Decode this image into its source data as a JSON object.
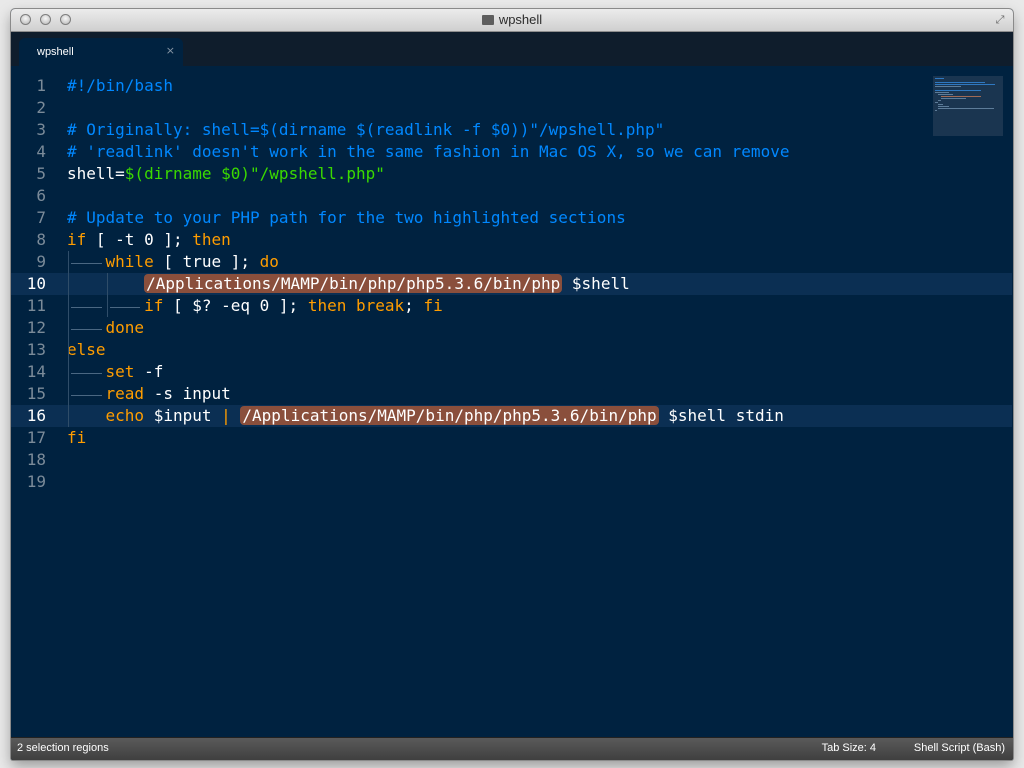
{
  "window": {
    "title": "wpshell"
  },
  "tabs": [
    {
      "label": "wpshell",
      "close": "×"
    }
  ],
  "editor": {
    "line_numbers": [
      "1",
      "2",
      "3",
      "4",
      "5",
      "6",
      "7",
      "8",
      "9",
      "10",
      "11",
      "12",
      "13",
      "14",
      "15",
      "16",
      "17",
      "18",
      "19"
    ],
    "highlighted_lines": [
      10,
      16
    ],
    "lines": [
      [
        {
          "t": "#!/bin/bash",
          "c": "comment"
        }
      ],
      [],
      [
        {
          "t": "# Originally: shell=$(dirname $(readlink -f $0))\"/wpshell.php\"",
          "c": "comment"
        }
      ],
      [
        {
          "t": "# 'readlink' doesn't work in the same fashion in Mac OS X, so we can remove",
          "c": "comment"
        }
      ],
      [
        {
          "t": "shell=",
          "c": "plain"
        },
        {
          "t": "$(",
          "c": "string"
        },
        {
          "t": "dirname $0",
          "c": "string"
        },
        {
          "t": ")",
          "c": "string"
        },
        {
          "t": "\"/wpshell.php\"",
          "c": "string"
        }
      ],
      [],
      [
        {
          "t": "# Update to your PHP path for the two highlighted sections",
          "c": "comment"
        }
      ],
      [
        {
          "t": "if",
          "c": "keyword"
        },
        {
          "t": " [ -t 0 ]; ",
          "c": "plain"
        },
        {
          "t": "then",
          "c": "keyword"
        }
      ],
      [
        {
          "t": "    ",
          "c": "plain"
        },
        {
          "t": "while",
          "c": "keyword"
        },
        {
          "t": " [ ",
          "c": "plain"
        },
        {
          "t": "true",
          "c": "plain"
        },
        {
          "t": " ]; ",
          "c": "plain"
        },
        {
          "t": "do",
          "c": "keyword"
        }
      ],
      [
        {
          "t": "        ",
          "c": "plain"
        },
        {
          "t": "/Applications/MAMP/bin/php/php5.3.6/bin/php",
          "c": "sel"
        },
        {
          "t": " $shell",
          "c": "plain"
        }
      ],
      [
        {
          "t": "        ",
          "c": "plain"
        },
        {
          "t": "if",
          "c": "keyword"
        },
        {
          "t": " [ $? -eq 0 ]; ",
          "c": "plain"
        },
        {
          "t": "then",
          "c": "keyword"
        },
        {
          "t": " ",
          "c": "plain"
        },
        {
          "t": "break",
          "c": "keyword"
        },
        {
          "t": "; ",
          "c": "plain"
        },
        {
          "t": "fi",
          "c": "keyword"
        }
      ],
      [
        {
          "t": "    ",
          "c": "plain"
        },
        {
          "t": "done",
          "c": "keyword"
        }
      ],
      [
        {
          "t": "else",
          "c": "keyword"
        }
      ],
      [
        {
          "t": "    ",
          "c": "plain"
        },
        {
          "t": "set",
          "c": "keyword"
        },
        {
          "t": " -f",
          "c": "plain"
        }
      ],
      [
        {
          "t": "    ",
          "c": "plain"
        },
        {
          "t": "read",
          "c": "keyword"
        },
        {
          "t": " -s input",
          "c": "plain"
        }
      ],
      [
        {
          "t": "    ",
          "c": "plain"
        },
        {
          "t": "echo",
          "c": "keyword"
        },
        {
          "t": " $input ",
          "c": "plain"
        },
        {
          "t": "|",
          "c": "keyword"
        },
        {
          "t": " ",
          "c": "plain"
        },
        {
          "t": "/Applications/MAMP/bin/php/php5.3.6/bin/php",
          "c": "sel"
        },
        {
          "t": " $shell stdin",
          "c": "plain"
        }
      ],
      [
        {
          "t": "fi",
          "c": "keyword"
        }
      ],
      [],
      []
    ]
  },
  "status": {
    "left": "2 selection regions",
    "tab_size": "Tab Size: 4",
    "syntax": "Shell Script (Bash)"
  },
  "colors": {
    "background": "#002240",
    "comment": "#0088ff",
    "keyword": "#ff9d00",
    "string": "#3ad900",
    "selection": "#8a4f3c"
  }
}
